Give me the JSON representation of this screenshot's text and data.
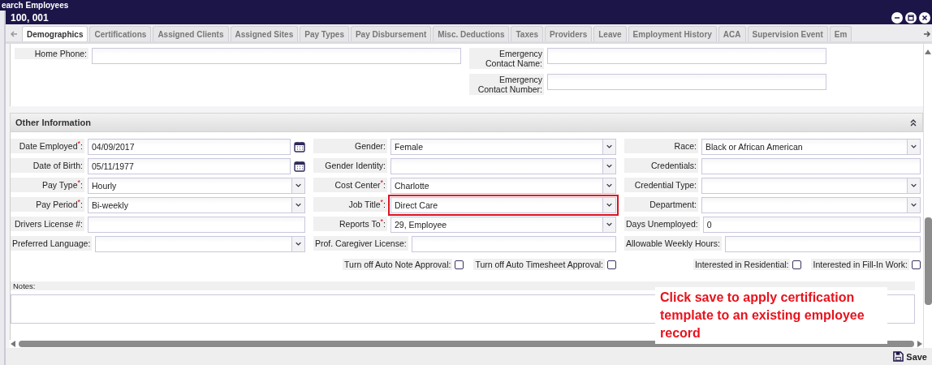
{
  "background_title": "earch Employees",
  "window": {
    "title": "100, 001"
  },
  "tabs": [
    {
      "label": "Demographics",
      "selected": true
    },
    {
      "label": "Certifications",
      "selected": false
    },
    {
      "label": "Assigned Clients",
      "selected": false
    },
    {
      "label": "Assigned Sites",
      "selected": false
    },
    {
      "label": "Pay Types",
      "selected": false
    },
    {
      "label": "Pay Disbursement",
      "selected": false
    },
    {
      "label": "Misc. Deductions",
      "selected": false
    },
    {
      "label": "Taxes",
      "selected": false
    },
    {
      "label": "Providers",
      "selected": false
    },
    {
      "label": "Leave",
      "selected": false
    },
    {
      "label": "Employment History",
      "selected": false
    },
    {
      "label": "ACA",
      "selected": false
    },
    {
      "label": "Supervision Event",
      "selected": false
    },
    {
      "label": "Em",
      "selected": false
    }
  ],
  "contact_left": [
    {
      "label": "Home Phone:"
    }
  ],
  "contact_right": [
    {
      "label": "Emergency Contact Name:"
    },
    {
      "label": "Emergency Contact Number:"
    }
  ],
  "section": {
    "title": "Other Information",
    "expanded": true
  },
  "columns": [
    [
      {
        "kind": "date",
        "label": "Date Employed$^{*}$:",
        "value": "04/09/2017"
      },
      {
        "kind": "date",
        "label": "Date of Birth:",
        "value": "05/11/1977"
      },
      {
        "kind": "select",
        "label": "Pay Type$^{*}$:",
        "value": "Hourly"
      },
      {
        "kind": "select",
        "label": "Pay Period$^{*}$:",
        "value": "Bi-weekly"
      },
      {
        "kind": "text",
        "label": "Drivers License #:"
      },
      {
        "kind": "select",
        "label": "Preferred Language:"
      }
    ],
    [
      {
        "kind": "select",
        "label": "Gender:",
        "value": "Female"
      },
      {
        "kind": "select",
        "label": "Gender Identity:"
      },
      {
        "kind": "select",
        "label": "Cost Center$^{*}$:",
        "value": "Charlotte"
      },
      {
        "kind": "select",
        "label": "Job Title$^{*}$:",
        "value": "Direct Care",
        "highlighted": true
      },
      {
        "kind": "select",
        "label": "Reports To$^{*}$:",
        "value": "29, Employee"
      },
      {
        "kind": "text",
        "label": "Prof. Caregiver License:"
      },
      {
        "kind": "checks",
        "items": [
          {
            "label": "Turn off Auto Note Approval:",
            "checked": false
          },
          {
            "label": "Turn off Auto Timesheet Approval:",
            "checked": false
          }
        ]
      }
    ],
    [
      {
        "kind": "select",
        "label": "Race:",
        "value": "Black or African American"
      },
      {
        "kind": "text",
        "label": "Credentials:"
      },
      {
        "kind": "select",
        "label": "Credential Type:"
      },
      {
        "kind": "select",
        "label": "Department:"
      },
      {
        "kind": "text",
        "label": "Days Unemployed:",
        "value": "0"
      },
      {
        "kind": "text",
        "label": "Allowable Weekly Hours:"
      },
      {
        "kind": "checks",
        "items": [
          {
            "label": "Interested in Residential:",
            "checked": false
          },
          {
            "label": "Interested in Fill-In Work:",
            "checked": false
          }
        ]
      }
    ]
  ],
  "notes": {
    "label": "Notes:"
  },
  "callout": "Click save to apply certification template to an existing employee record",
  "save_button": "Save"
}
